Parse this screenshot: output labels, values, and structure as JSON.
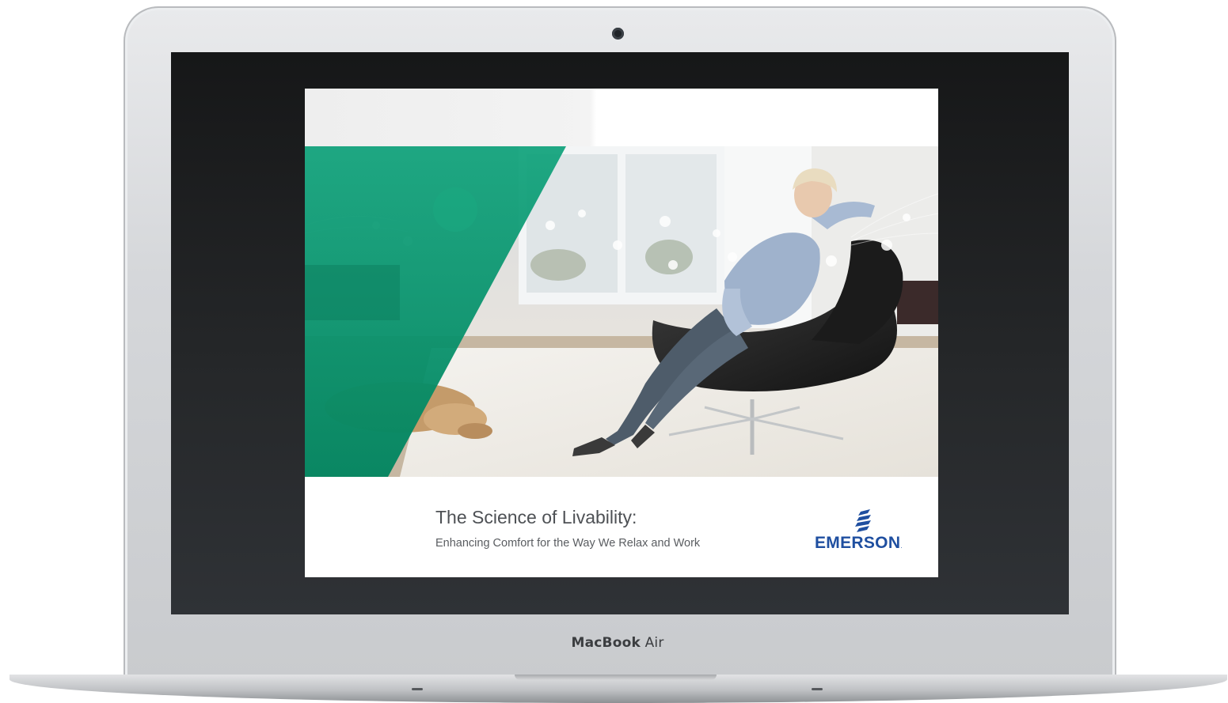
{
  "device": {
    "brand_bold": "MacBook",
    "brand_regular": "Air"
  },
  "document": {
    "title": "The Science of Livability:",
    "subtitle": "Enhancing Comfort for the Way We Relax and Work",
    "logo_text": "EMERSON",
    "logo_suffix": "."
  },
  "colors": {
    "accent_green": "#00916a",
    "brand_blue": "#1f4fa0"
  },
  "icons": [
    "webcam-icon",
    "emerson-logo"
  ]
}
